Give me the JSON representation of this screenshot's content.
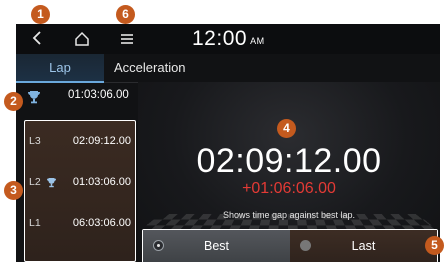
{
  "statusbar": {
    "time": "12:00",
    "ampm": "AM"
  },
  "tabs": [
    {
      "label": "Lap",
      "active": true
    },
    {
      "label": "Acceleration",
      "active": false
    }
  ],
  "best_lap": {
    "time": "01:03:06.00"
  },
  "laps": [
    {
      "name": "L3",
      "time": "02:09:12.00",
      "best": false
    },
    {
      "name": "L2",
      "time": "01:03:06.00",
      "best": true
    },
    {
      "name": "L1",
      "time": "06:03:06.00",
      "best": false
    }
  ],
  "main": {
    "current_time": "02:09:12.00",
    "time_gap": "+01:06:06.00",
    "caption": "Shows time gap against best lap."
  },
  "compare_buttons": {
    "best_label": "Best",
    "last_label": "Last",
    "selected": "Best"
  },
  "callouts": [
    "1",
    "2",
    "3",
    "4",
    "5",
    "6"
  ],
  "colors": {
    "accent_blue": "#6aa8dc",
    "gap_red": "#e33a35",
    "callout_orange": "#c45a1e"
  }
}
